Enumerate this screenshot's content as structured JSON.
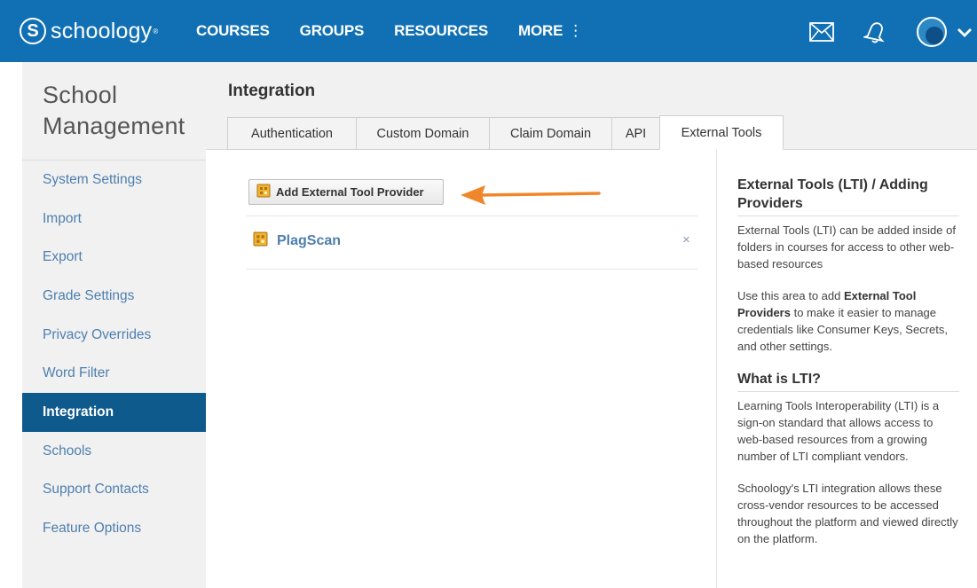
{
  "header": {
    "brand": "schoology",
    "brand_mark": "S",
    "nav": [
      "COURSES",
      "GROUPS",
      "RESOURCES",
      "MORE"
    ],
    "more_icon": "vertical-dots-icon",
    "icons": [
      "mail-icon",
      "bell-icon",
      "avatar",
      "chevron-down-icon"
    ]
  },
  "sidebar": {
    "title_line1": "School",
    "title_line2": "Management",
    "items": [
      {
        "label": "System Settings"
      },
      {
        "label": "Import"
      },
      {
        "label": "Export"
      },
      {
        "label": "Grade Settings"
      },
      {
        "label": "Privacy Overrides"
      },
      {
        "label": "Word Filter"
      },
      {
        "label": "Integration",
        "active": true
      },
      {
        "label": "Schools"
      },
      {
        "label": "Support Contacts"
      },
      {
        "label": "Feature Options"
      }
    ]
  },
  "main": {
    "title": "Integration",
    "tabs": [
      {
        "label": "Authentication"
      },
      {
        "label": "Custom Domain"
      },
      {
        "label": "Claim Domain"
      },
      {
        "label": "API"
      },
      {
        "label": "External Tools",
        "active": true
      }
    ],
    "add_button_label": "Add External Tool Provider",
    "providers": [
      {
        "name": "PlagScan",
        "icon": "external-tool-icon"
      }
    ],
    "remove_label": "×"
  },
  "help": {
    "heading1": "External Tools (LTI) / Adding Providers",
    "para1": "External Tools (LTI) can be added inside of folders in courses for access to other web-based resources",
    "para2_pre": "Use this area to add ",
    "para2_bold": "External Tool Providers",
    "para2_post": " to make it easier to manage credentials like Consumer Keys, Secrets, and other settings.",
    "heading2": "What is LTI?",
    "para3": "Learning Tools Interoperability (LTI) is a sign-on standard that allows access to web-based resources from a growing number of LTI compliant vendors.",
    "para4": "Schoology's LTI integration allows these cross-vendor resources to be accessed throughout the platform and viewed directly on the platform."
  },
  "colors": {
    "header_bg": "#1170b4",
    "active_sidebar": "#0f5a8c",
    "link": "#4e7fae",
    "annotation_arrow": "#f0862a"
  }
}
